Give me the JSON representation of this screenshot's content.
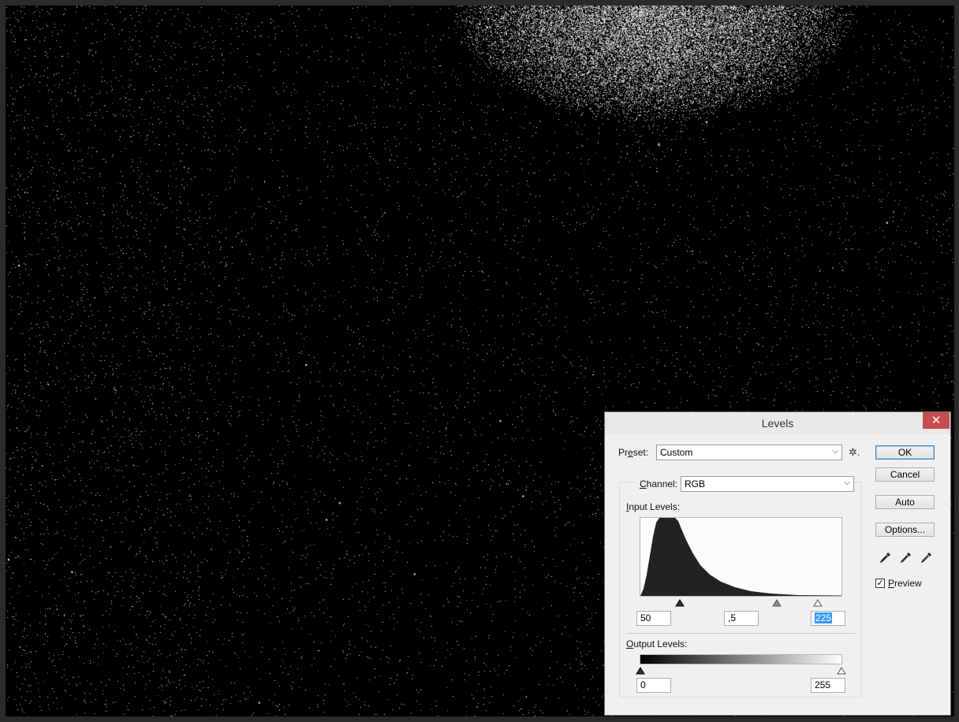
{
  "dialog": {
    "title": "Levels",
    "close_symbol": "✕",
    "preset": {
      "label_prefix": "Pr",
      "label_underline": "e",
      "label_suffix": "set:",
      "value": "Custom"
    },
    "channel": {
      "label_underline": "C",
      "label_suffix": "hannel:",
      "value": "RGB"
    },
    "input_levels": {
      "label_underline": "I",
      "label_suffix": "nput Levels:",
      "black": "50",
      "mid": ",5",
      "white": "225"
    },
    "output_levels": {
      "label_underline": "O",
      "label_suffix": "utput Levels:",
      "black": "0",
      "white": "255"
    },
    "buttons": {
      "ok": "OK",
      "cancel": "Cancel",
      "auto": "Auto",
      "options": "Options..."
    },
    "preview": {
      "checked": true,
      "check_mark": "✓",
      "label_underline": "P",
      "label_suffix": "review"
    },
    "gear_glyph": "✲.",
    "icons": [
      "black-eyedropper-icon",
      "gray-eyedropper-icon",
      "white-eyedropper-icon",
      "gear-icon"
    ]
  },
  "colors": {
    "close_button": "#c74c4b",
    "histogram_fill": "#222222",
    "selection": "#3399ff"
  }
}
